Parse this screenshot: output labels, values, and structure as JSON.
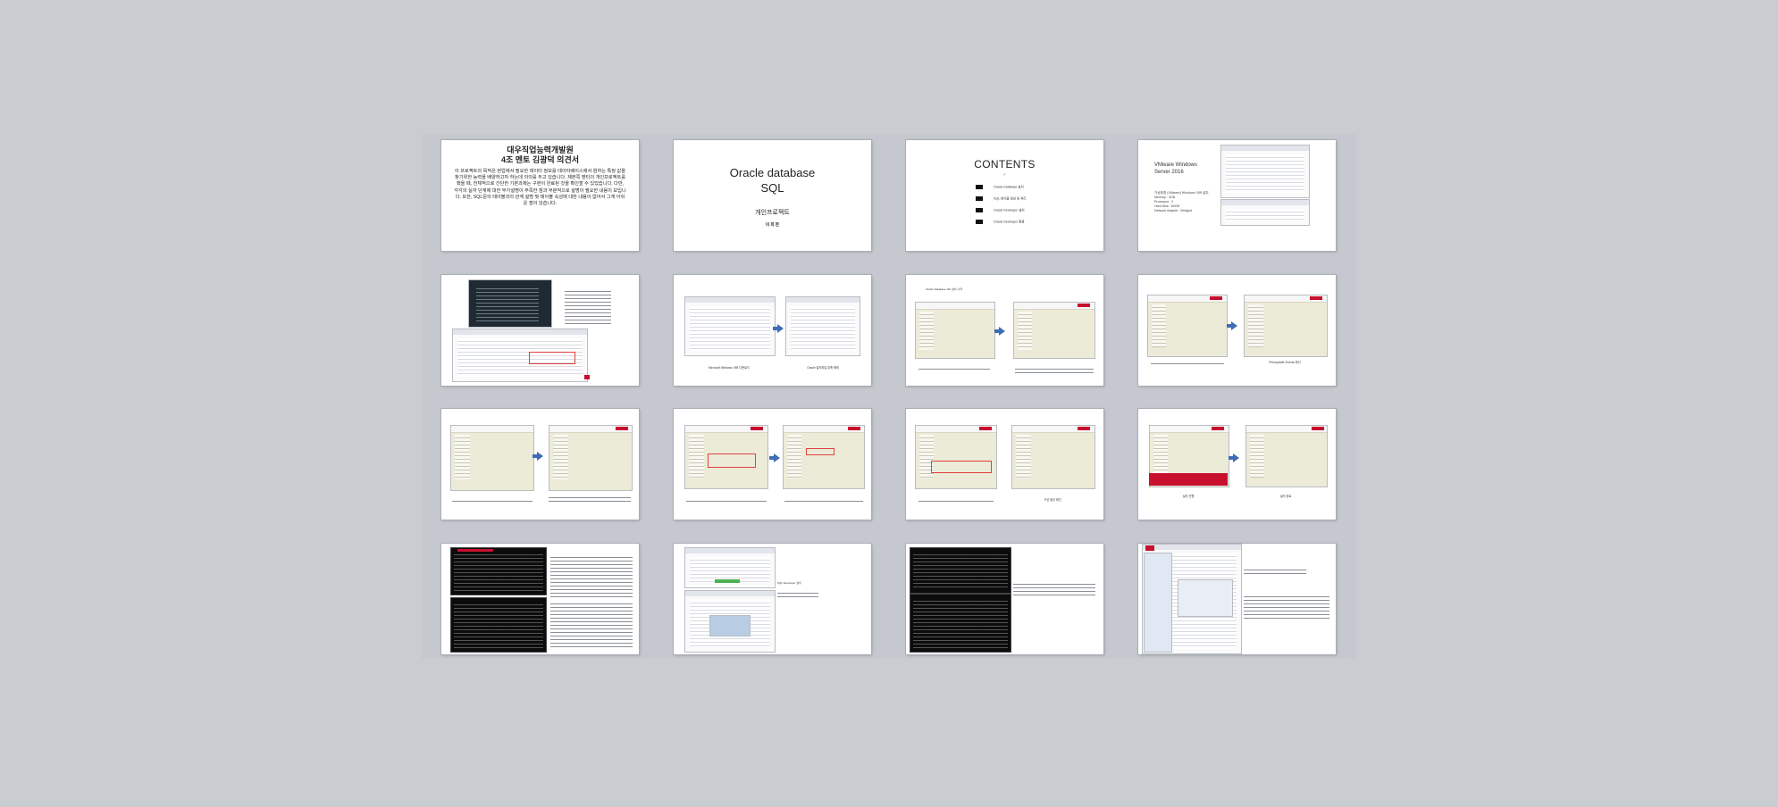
{
  "slides": [
    {
      "index": 1,
      "title_line1": "대우직업능력개발원",
      "title_line2": "4조 멘토 김광덕 의견서",
      "body": "이 프로젝트의 목적은 현업에서 필요한 데이터 정보를 데이터베이스에서 원하는 특정 값을 찾기위한 능력을 배양하고자 하는데 의의를 두고 있습니다. 제본쪽 멘티의 개인프로젝트를 했을 때, 전체적으로 간단한 기본과제는 구현이 완료된 것을 확인할 수 있었습니다. 다만, 각각의 실자 단계에 대한 부가설명이 부족한 점과 부분적으로 설명이 필요한 내용이 보입니다. 또한, SQL문의 테이블과의 관계 설명 및 테이블 속성에 대한 내용이 없어서 그게 아쉬운 점이 있습니다."
    },
    {
      "index": 2,
      "title_line1": "Oracle database",
      "title_line2": "SQL",
      "subtitle": "개인프로젝트",
      "author": "이 희 현"
    },
    {
      "index": 3,
      "title": "CONTENTS",
      "items": [
        "Oracle Database 설치",
        "SQL 테이블 생성 및 쿼리",
        "Oracle Developer 설치",
        "Oracle Developer 활용"
      ]
    },
    {
      "index": 4,
      "title_line1": "VMware Windows",
      "title_line2": "Server 2016",
      "info": "가상환경 (VMware) Windows 서버 설치\nMemory : 4GB\nProcessor : 2\nHard Disk : 60GB\nNetwork Adapter : Bridged"
    }
  ],
  "captions": {
    "s6_left": "Microsoft Windows 서버 다운로드",
    "s6_right": "Oracle 설치파일 압축 해제",
    "s7_top": "Oracle Database 19c 설치 시작",
    "s8_right": "Prerequisite Checks 확인",
    "s11_right": "구성 옵션 확인",
    "s12_left": "설치 진행",
    "s12_right": "설치 완료",
    "s14_note": "SQL Developer 설치"
  },
  "colors": {
    "background": "#c9ccd1",
    "sorter": "#c5c8ce",
    "slide": "#ffffff",
    "arrow": "#3e6db4",
    "oracle_red": "#c8102e"
  }
}
